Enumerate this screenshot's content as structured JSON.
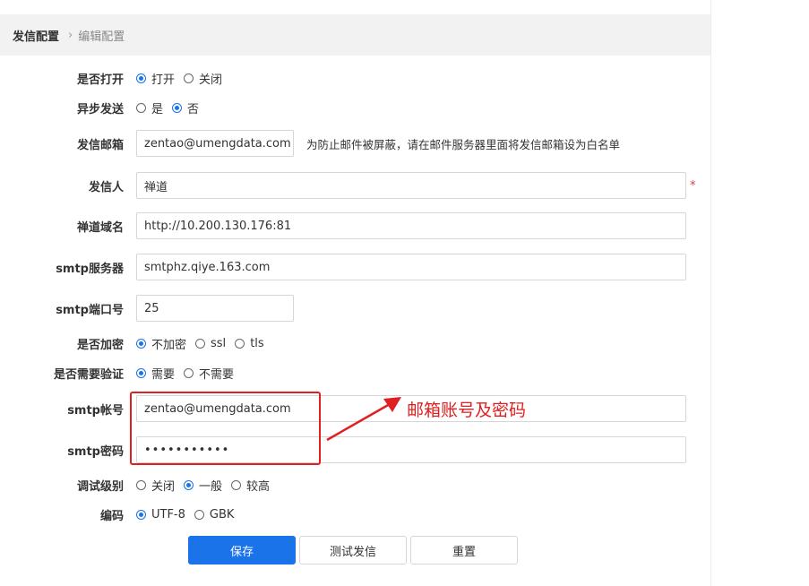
{
  "breadcrumb": {
    "main": "发信配置",
    "sub": "编辑配置"
  },
  "form": {
    "turn_on": {
      "label": "是否打开",
      "options": [
        "打开",
        "关闭"
      ],
      "selected": 0
    },
    "async_send": {
      "label": "异步发送",
      "options": [
        "是",
        "否"
      ],
      "selected": 1
    },
    "sender_email": {
      "label": "发信邮箱",
      "value": "zentao@umengdata.com",
      "hint": "为防止邮件被屏蔽，请在邮件服务器里面将发信邮箱设为白名单"
    },
    "sender_name": {
      "label": "发信人",
      "value": "禅道",
      "required_mark": "*"
    },
    "domain": {
      "label": "禅道域名",
      "value": "http://10.200.130.176:81"
    },
    "smtp_server": {
      "label": "smtp服务器",
      "value": "smtphz.qiye.163.com"
    },
    "smtp_port": {
      "label": "smtp端口号",
      "value": "25"
    },
    "encryption": {
      "label": "是否加密",
      "options": [
        "不加密",
        "ssl",
        "tls"
      ],
      "selected": 0
    },
    "need_auth": {
      "label": "是否需要验证",
      "options": [
        "需要",
        "不需要"
      ],
      "selected": 0
    },
    "smtp_account": {
      "label": "smtp帐号",
      "value": "zentao@umengdata.com"
    },
    "smtp_password": {
      "label": "smtp密码",
      "value": "•••••••••••"
    },
    "debug_level": {
      "label": "调试级别",
      "options": [
        "关闭",
        "一般",
        "较高"
      ],
      "selected": 1
    },
    "charset": {
      "label": "编码",
      "options": [
        "UTF-8",
        "GBK"
      ],
      "selected": 0
    }
  },
  "buttons": {
    "save": "保存",
    "test": "测试发信",
    "reset": "重置"
  },
  "annotation": {
    "text": "邮箱账号及密码",
    "color": "#e02020"
  },
  "colors": {
    "accent": "#1a73e8",
    "header_bg": "#f2f2f2"
  }
}
